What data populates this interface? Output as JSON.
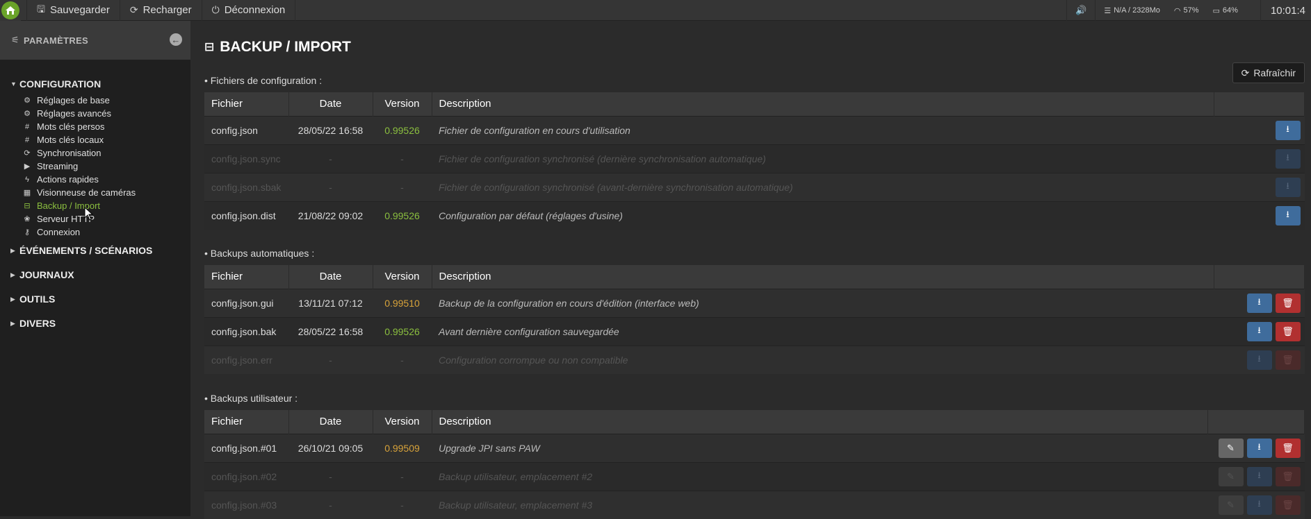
{
  "topbar": {
    "save_label": "Sauvegarder",
    "reload_label": "Recharger",
    "logout_label": "Déconnexion",
    "memory": "N/A / 2328Mo",
    "wifi": "57%",
    "battery": "64%",
    "clock": "10:01:4"
  },
  "sidebar": {
    "header": "PARAMÈTRES",
    "sections": {
      "configuration": "CONFIGURATION",
      "events": "ÉVÉNEMENTS / SCÉNARIOS",
      "logs": "JOURNAUX",
      "tools": "OUTILS",
      "misc": "DIVERS"
    },
    "items": [
      {
        "label": "Réglages de base",
        "icon": "gear-icon"
      },
      {
        "label": "Réglages avancés",
        "icon": "gears-icon"
      },
      {
        "label": "Mots clés persos",
        "icon": "hashtag-icon"
      },
      {
        "label": "Mots clés locaux",
        "icon": "hashtag-icon"
      },
      {
        "label": "Synchronisation",
        "icon": "sync-icon"
      },
      {
        "label": "Streaming",
        "icon": "youtube-icon"
      },
      {
        "label": "Actions rapides",
        "icon": "bolt-icon"
      },
      {
        "label": "Visionneuse de caméras",
        "icon": "grid-icon"
      },
      {
        "label": "Backup / Import",
        "icon": "hdd-icon"
      },
      {
        "label": "Serveur HTTP",
        "icon": "paw-icon"
      },
      {
        "label": "Connexion",
        "icon": "key-icon"
      }
    ]
  },
  "main": {
    "title": "BACKUP / IMPORT",
    "refresh_label": "Rafraîchir",
    "headers": {
      "file": "Fichier",
      "date": "Date",
      "version": "Version",
      "description": "Description"
    },
    "config_section": "• Fichiers de configuration :",
    "config_rows": [
      {
        "file": "config.json",
        "date": "28/05/22 16:58",
        "version": "0.99526",
        "description": "Fichier de configuration en cours d'utilisation"
      },
      {
        "file": "config.json.sync",
        "date": "-",
        "version": "-",
        "description": "Fichier de configuration synchronisé (dernière synchronisation automatique)"
      },
      {
        "file": "config.json.sbak",
        "date": "-",
        "version": "-",
        "description": "Fichier de configuration synchronisé (avant-dernière synchronisation automatique)"
      },
      {
        "file": "config.json.dist",
        "date": "21/08/22 09:02",
        "version": "0.99526",
        "description": "Configuration par défaut (réglages d'usine)"
      }
    ],
    "auto_section": "• Backups automatiques :",
    "auto_rows": [
      {
        "file": "config.json.gui",
        "date": "13/11/21 07:12",
        "version": "0.99510",
        "description": "Backup de la configuration en cours d'édition (interface web)"
      },
      {
        "file": "config.json.bak",
        "date": "28/05/22 16:58",
        "version": "0.99526",
        "description": "Avant dernière configuration sauvegardée"
      },
      {
        "file": "config.json.err",
        "date": "-",
        "version": "-",
        "description": "Configuration corrompue ou non compatible"
      }
    ],
    "user_section": "• Backups utilisateur :",
    "user_rows": [
      {
        "file": "config.json.#01",
        "date": "26/10/21 09:05",
        "version": "0.99509",
        "description": "Upgrade JPI sans PAW"
      },
      {
        "file": "config.json.#02",
        "date": "-",
        "version": "-",
        "description": "Backup utilisateur, emplacement #2"
      },
      {
        "file": "config.json.#03",
        "date": "-",
        "version": "-",
        "description": "Backup utilisateur, emplacement #3"
      }
    ]
  },
  "colors": {
    "accent_green": "#8bbf3f",
    "version_orange": "#d8a33a",
    "download_blue": "#3f6c9c",
    "delete_red": "#b13030"
  }
}
